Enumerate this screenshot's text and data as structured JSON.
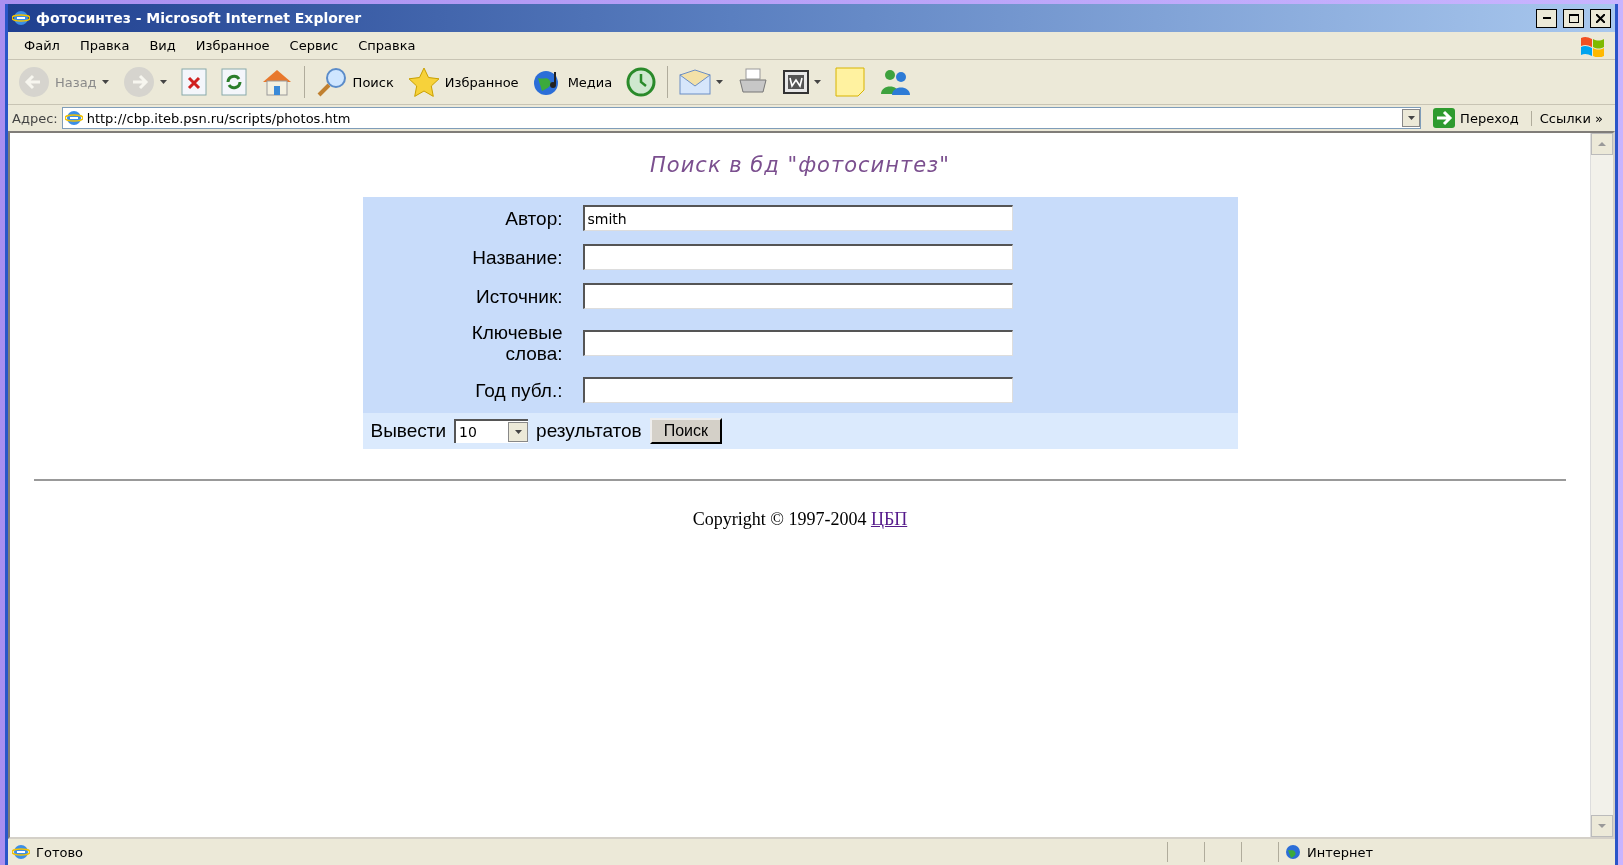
{
  "window": {
    "title": "фотосинтез - Microsoft Internet Explorer"
  },
  "menu": [
    {
      "label": "Файл"
    },
    {
      "label": "Правка"
    },
    {
      "label": "Вид"
    },
    {
      "label": "Избранное"
    },
    {
      "label": "Сервис"
    },
    {
      "label": "Справка"
    }
  ],
  "toolbar": [
    {
      "kind": "back",
      "label": "Назад",
      "disabled": true,
      "dropdown": true
    },
    {
      "kind": "forward",
      "disabled": true,
      "dropdown": true
    },
    {
      "kind": "stop",
      "disabled": false,
      "dropdown": false
    },
    {
      "kind": "refresh",
      "disabled": false,
      "dropdown": false
    },
    {
      "kind": "home",
      "disabled": false,
      "dropdown": false
    },
    {
      "kind": "search",
      "label": "Поиск",
      "disabled": false,
      "dropdown": false
    },
    {
      "kind": "favorites",
      "label": "Избранное",
      "disabled": false,
      "dropdown": false
    },
    {
      "kind": "media",
      "label": "Медиа",
      "disabled": false,
      "dropdown": false
    },
    {
      "kind": "history",
      "disabled": false,
      "dropdown": false
    },
    {
      "kind": "mail",
      "disabled": false,
      "dropdown": true
    },
    {
      "kind": "print",
      "disabled": false,
      "dropdown": false
    },
    {
      "kind": "edit",
      "disabled": false,
      "dropdown": true
    },
    {
      "kind": "notes",
      "disabled": false,
      "dropdown": false
    },
    {
      "kind": "messenger",
      "disabled": false,
      "dropdown": false
    }
  ],
  "address": {
    "label": "Адрес:",
    "value": "http://cbp.iteb.psn.ru/scripts/photos.htm",
    "go": "Переход",
    "links": "Ссылки",
    "chevron": "»"
  },
  "page": {
    "heading": "Поиск в бд \"фотосинтез\"",
    "fields": [
      {
        "label": "Автор:",
        "value": "smith"
      },
      {
        "label": "Название:"
      },
      {
        "label": "Источник:"
      },
      {
        "label": "Ключевые слова:"
      },
      {
        "label": "Год публ.:"
      }
    ],
    "results": {
      "before": "Вывести",
      "count": "10",
      "after": "результатов",
      "button": "Поиск"
    },
    "copyright": "Copyright © 1997-2004",
    "link": "ЦБП"
  },
  "status": {
    "text": "Готово",
    "zone": "Интернет"
  }
}
